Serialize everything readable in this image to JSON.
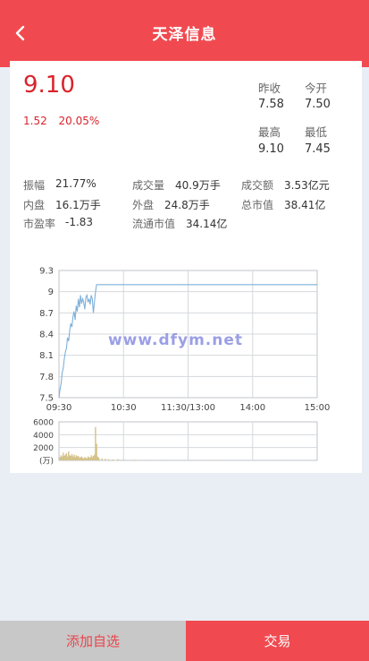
{
  "header": {
    "title": "天泽信息",
    "back_icon": "chevron-left-icon"
  },
  "quote": {
    "price": "9.10",
    "change": "1.52",
    "change_pct": "20.05%",
    "prev_close_label": "昨收",
    "prev_close": "7.58",
    "open_label": "今开",
    "open": "7.50",
    "high_label": "最高",
    "high": "9.10",
    "low_label": "最低",
    "low": "7.45"
  },
  "stats": [
    {
      "label": "振幅",
      "value": "21.77%"
    },
    {
      "label": "成交量",
      "value": "40.9万手"
    },
    {
      "label": "成交额",
      "value": "3.53亿元"
    },
    {
      "label": "内盘",
      "value": "16.1万手"
    },
    {
      "label": "外盘",
      "value": "24.8万手"
    },
    {
      "label": "总市值",
      "value": "38.41亿"
    },
    {
      "label": "市盈率",
      "value": "-1.83"
    },
    {
      "label": "流通市值",
      "value": "34.14亿"
    }
  ],
  "watermark": "www.dfym.net",
  "chart_data": {
    "type": "line",
    "price_chart": {
      "y_ticks": [
        "9.3",
        "9",
        "8.7",
        "8.4",
        "8.1",
        "7.8",
        "7.5"
      ],
      "ylim": [
        7.5,
        9.3
      ],
      "x_ticks": [
        "09:30",
        "10:30",
        "11:30/13:00",
        "14:00",
        "15:00"
      ],
      "x_range_minutes": [
        0,
        240
      ],
      "series": [
        {
          "values": [
            [
              0,
              7.5
            ],
            [
              1,
              7.62
            ],
            [
              2,
              7.7
            ],
            [
              3,
              7.85
            ],
            [
              4,
              7.92
            ],
            [
              5,
              8.05
            ],
            [
              6,
              8.15
            ],
            [
              7,
              8.2
            ],
            [
              8,
              8.35
            ],
            [
              9,
              8.3
            ],
            [
              10,
              8.45
            ],
            [
              11,
              8.55
            ],
            [
              12,
              8.5
            ],
            [
              13,
              8.65
            ],
            [
              14,
              8.72
            ],
            [
              15,
              8.6
            ],
            [
              16,
              8.8
            ],
            [
              17,
              8.72
            ],
            [
              18,
              8.9
            ],
            [
              19,
              8.78
            ],
            [
              20,
              8.95
            ],
            [
              21,
              8.83
            ],
            [
              22,
              8.9
            ],
            [
              23,
              8.85
            ],
            [
              24,
              8.75
            ],
            [
              25,
              8.92
            ],
            [
              26,
              8.95
            ],
            [
              27,
              8.85
            ],
            [
              28,
              8.9
            ],
            [
              29,
              8.82
            ],
            [
              30,
              8.95
            ],
            [
              31,
              8.9
            ],
            [
              32,
              8.7
            ],
            [
              33,
              8.85
            ],
            [
              34,
              9.0
            ],
            [
              35,
              9.1
            ],
            [
              60,
              9.1
            ],
            [
              120,
              9.1
            ],
            [
              180,
              9.1
            ],
            [
              240,
              9.1
            ]
          ],
          "color": "#7fb0d8"
        }
      ]
    },
    "volume_chart": {
      "y_ticks": [
        "6000",
        "4000",
        "2000",
        "(万)"
      ],
      "ylim": [
        0,
        6000
      ],
      "x_range_minutes": [
        0,
        240
      ],
      "values": [
        [
          1,
          500
        ],
        [
          2,
          800
        ],
        [
          3,
          600
        ],
        [
          4,
          1200
        ],
        [
          5,
          700
        ],
        [
          6,
          900
        ],
        [
          7,
          1100
        ],
        [
          8,
          600
        ],
        [
          9,
          1400
        ],
        [
          10,
          800
        ],
        [
          11,
          700
        ],
        [
          12,
          1000
        ],
        [
          13,
          600
        ],
        [
          14,
          900
        ],
        [
          15,
          500
        ],
        [
          16,
          800
        ],
        [
          17,
          600
        ],
        [
          18,
          700
        ],
        [
          19,
          400
        ],
        [
          20,
          500
        ],
        [
          21,
          600
        ],
        [
          22,
          400
        ],
        [
          23,
          300
        ],
        [
          24,
          500
        ],
        [
          25,
          400
        ],
        [
          26,
          300
        ],
        [
          27,
          600
        ],
        [
          28,
          500
        ],
        [
          29,
          400
        ],
        [
          30,
          800
        ],
        [
          31,
          500
        ],
        [
          32,
          700
        ],
        [
          33,
          900
        ],
        [
          34,
          5200
        ],
        [
          35,
          2600
        ],
        [
          36,
          600
        ],
        [
          37,
          400
        ],
        [
          40,
          300
        ],
        [
          43,
          250
        ],
        [
          46,
          200
        ],
        [
          50,
          150
        ],
        [
          55,
          200
        ],
        [
          60,
          120
        ],
        [
          70,
          100
        ],
        [
          80,
          90
        ],
        [
          95,
          80
        ],
        [
          110,
          70
        ],
        [
          130,
          60
        ],
        [
          150,
          60
        ],
        [
          170,
          50
        ],
        [
          190,
          50
        ],
        [
          210,
          40
        ],
        [
          230,
          40
        ]
      ],
      "color": "#d4c28a"
    }
  },
  "footer": {
    "watchlist_label": "添加自选",
    "trade_label": "交易"
  }
}
